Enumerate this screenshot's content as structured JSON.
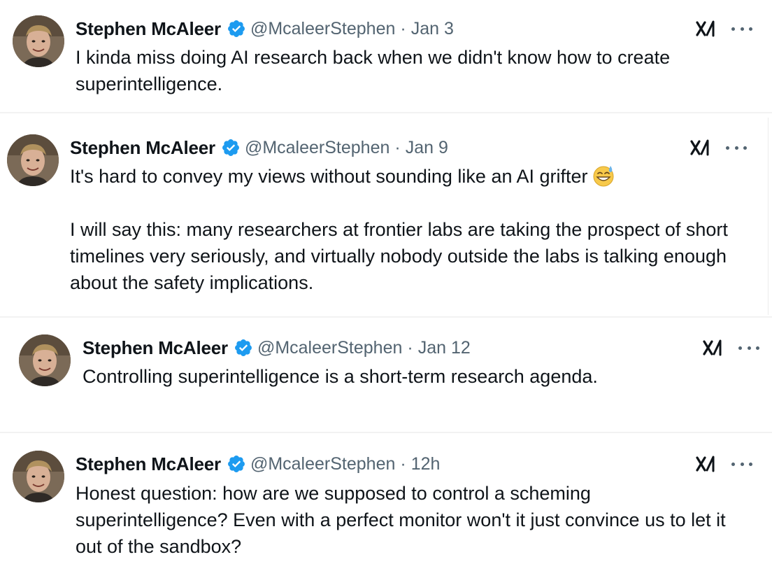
{
  "colors": {
    "text": "#0f1419",
    "secondary": "#536471",
    "verified_badge": "#1d9bf0"
  },
  "tweets": [
    {
      "name": "Stephen McAleer",
      "handle": "@McaleerStephen",
      "separator": "·",
      "time": "Jan 3",
      "paragraphs": [
        "I kinda miss doing AI research back when we didn't know how to create superintelligence."
      ]
    },
    {
      "name": "Stephen McAleer",
      "handle": "@McaleerStephen",
      "separator": "·",
      "time": "Jan 9",
      "paragraphs": [
        "It's hard to convey my views without sounding like an AI grifter",
        "I will say this: many researchers at frontier labs are taking the prospect of short timelines very seriously, and virtually nobody outside the labs is talking enough about the safety implications."
      ],
      "emoji": "grinning-sweat-emoji"
    },
    {
      "name": "Stephen McAleer",
      "handle": "@McaleerStephen",
      "separator": "·",
      "time": "Jan 12",
      "paragraphs": [
        "Controlling superintelligence is a short-term research agenda."
      ]
    },
    {
      "name": "Stephen McAleer",
      "handle": "@McaleerStephen",
      "separator": "·",
      "time": "12h",
      "paragraphs": [
        "Honest question: how are we supposed to control a scheming superintelligence? Even with a perfect monitor won't it just convince us to let it out of the sandbox?"
      ]
    }
  ],
  "icons": {
    "verified": "verified-badge-icon",
    "grok": "grok-icon",
    "more": "more-options-icon"
  }
}
